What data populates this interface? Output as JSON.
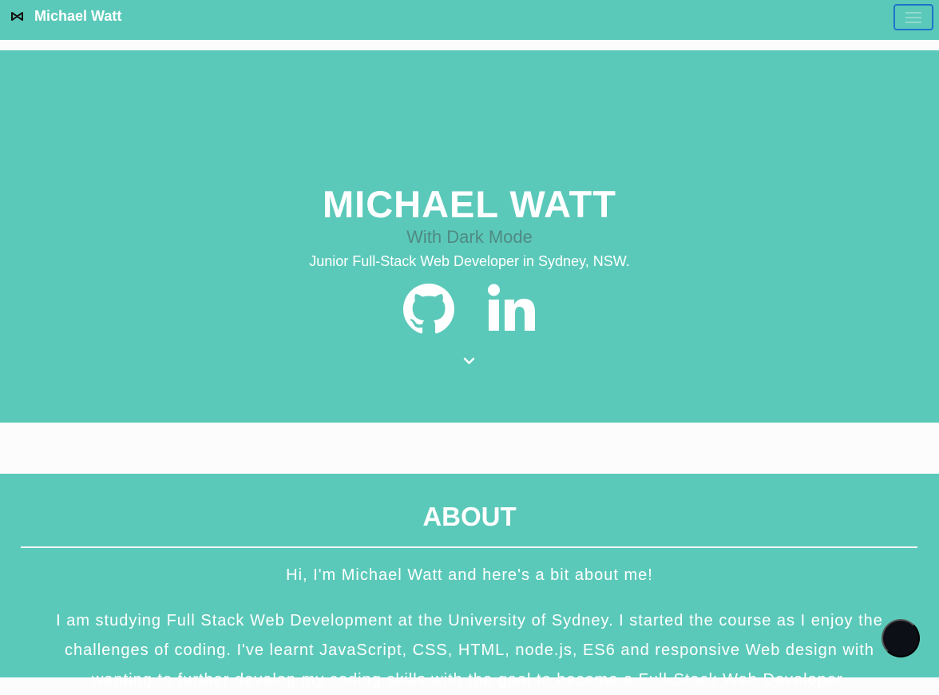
{
  "navbar": {
    "brand_icon": "bowtie-logo-icon",
    "brand_label": "Michael Watt",
    "toggler_icon": "hamburger-menu-icon",
    "toggler_border_color": "#1e73c9"
  },
  "hero": {
    "title": "MICHAEL WATT",
    "subtitle": "With Dark Mode",
    "tagline": "Junior Full-Stack Web Developer in Sydney, NSW.",
    "social_icons": [
      "github-icon",
      "linkedin-icon"
    ],
    "scroll_icon": "chevron-down-icon"
  },
  "about": {
    "heading": "ABOUT",
    "intro": "Hi, I'm Michael Watt and here's a bit about me!",
    "body": "I am studying Full Stack Web Development at the University of Sydney. I started the course as I enjoy the challenges of coding. I've learnt JavaScript, CSS, HTML, node.js, ES6 and responsive Web design with wanting to further develop my coding skills with the goal to become a Full-Stack Web Developer."
  },
  "dark_mode_toggle_icon": "dark-mode-toggle-icon",
  "colors": {
    "accent": "#5bc9b9",
    "subtitle_text": "#4f8a84",
    "page_background": "#fcfcfd",
    "dark_mode_button": "#0d0f16"
  }
}
